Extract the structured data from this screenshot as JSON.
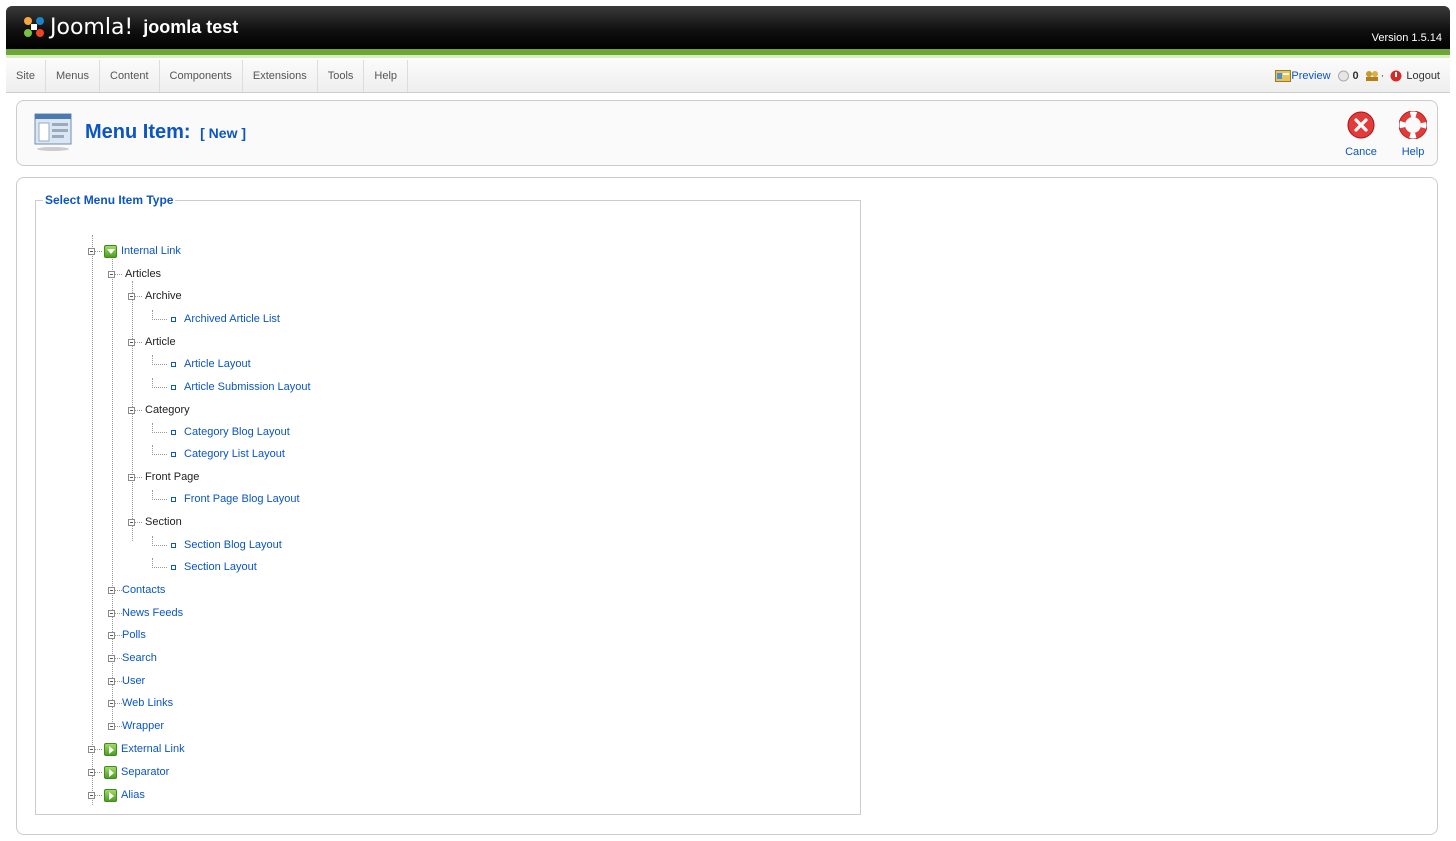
{
  "header": {
    "logo_text": "Joomla!",
    "site_name": "joomla test",
    "version": "Version 1.5.14"
  },
  "menubar": {
    "items": [
      "Site",
      "Menus",
      "Content",
      "Components",
      "Extensions",
      "Tools",
      "Help"
    ],
    "status": {
      "preview": "Preview",
      "messages_count": "0",
      "users_count": "·",
      "logout": "Logout"
    }
  },
  "toolbar": {
    "title": "Menu Item:",
    "subtitle": "[ New ]",
    "cancel_label": "Cance",
    "help_label": "Help"
  },
  "tree": {
    "legend": "Select Menu Item Type",
    "internal_link": "Internal Link",
    "articles": "Articles",
    "archive": "Archive",
    "archived_article_list": "Archived Article List",
    "article": "Article",
    "article_layout": "Article Layout",
    "article_submission_layout": "Article Submission Layout",
    "category": "Category",
    "category_blog_layout": "Category Blog Layout",
    "category_list_layout": "Category List Layout",
    "front_page": "Front Page",
    "front_page_blog_layout": "Front Page Blog Layout",
    "section": "Section",
    "section_blog_layout": "Section Blog Layout",
    "section_layout": "Section Layout",
    "contacts": "Contacts",
    "news_feeds": "News Feeds",
    "polls": "Polls",
    "search": "Search",
    "user": "User",
    "web_links": "Web Links",
    "wrapper": "Wrapper",
    "external_link": "External Link",
    "separator": "Separator",
    "alias": "Alias"
  },
  "colors": {
    "link_blue": "#0b55c4",
    "header_green": "#6da932"
  }
}
